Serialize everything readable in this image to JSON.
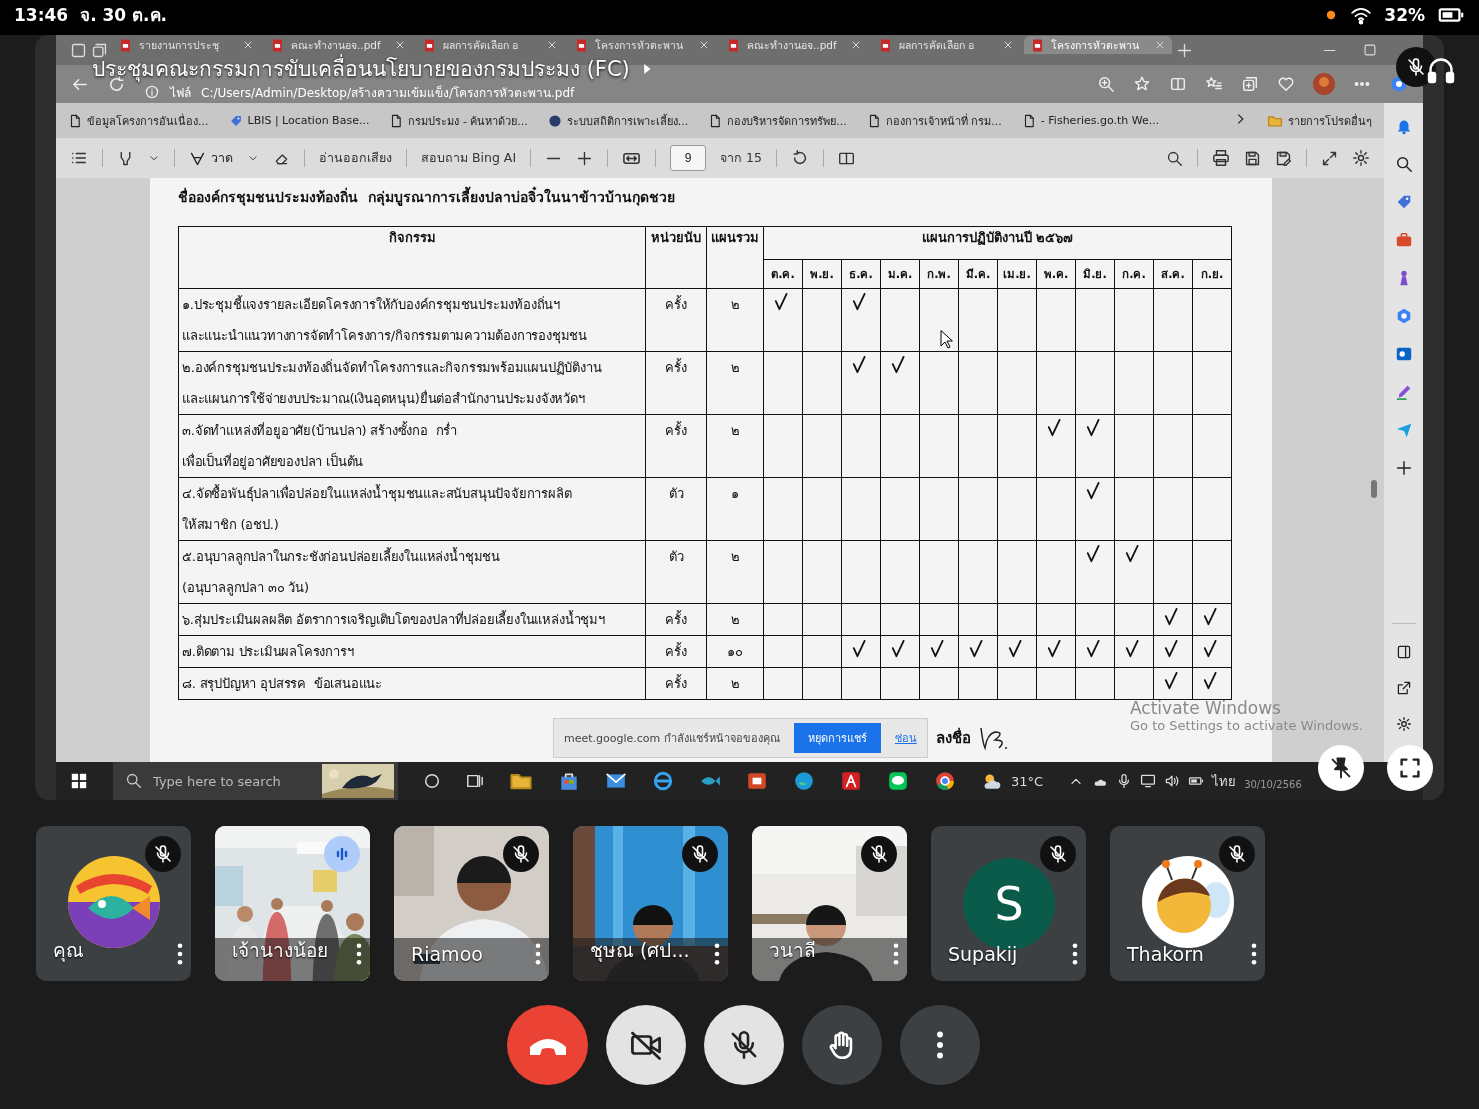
{
  "status_bar": {
    "time": "13:46",
    "date": "จ. 30 ต.ค.",
    "battery": "32%"
  },
  "meeting": {
    "title": "ประชุมคณะกรรมการขับเคลื่อนนโยบายของกรมประมง (FC)"
  },
  "browser": {
    "tabs": [
      {
        "title": "รายงานการประชุ",
        "selected": false
      },
      {
        "title": "คณะทำงานอจ..pdf",
        "selected": false
      },
      {
        "title": "ผลการคัดเลือก อ",
        "selected": false
      },
      {
        "title": "โครงการหัวตะพาน",
        "selected": false
      },
      {
        "title": "คณะทำงานอจ..pdf",
        "selected": false
      },
      {
        "title": "ผลการคัดเลือก อ",
        "selected": false
      },
      {
        "title": "โครงการหัวตะพาน",
        "selected": true
      }
    ],
    "address": {
      "scheme": "ไฟล์",
      "url": "C:/Users/Admin/Desktop/สร้างความเข้มแข็ง/โครงการหัวตะพาน.pdf"
    },
    "bookmarks": [
      "ข้อมูลโครงการอันเนื่อง...",
      "LBIS | Location Base...",
      "กรมประมง - ค้นหาด้วย...",
      "ระบบสถิติการเพาะเลี้ยง...",
      "กองบริหารจัดการทรัพย...",
      "กองการเจ้าหน้าที่ กรม...",
      "- Fisheries.go.th We..."
    ],
    "other_favorites": "รายการโปรดอื่นๆ"
  },
  "pdf_toolbar": {
    "draw": "วาด",
    "read_aloud": "อ่านออกเสียง",
    "ask": "สอบถาม Bing AI",
    "page": "9",
    "page_count": "จาก 15"
  },
  "document": {
    "heading": "ชื่อองค์กรชุมชนประมงท้องถิ่น  กลุ่มบูรณาการเลี้ยงปลาบ่อจิ๋วในนาข้าวบ้านกุดชวย",
    "table": {
      "activity_header": "กิจกรรม",
      "unit_header": "หน่วยนับ",
      "total_header": "แผนรวม",
      "plan_header": "แผนการปฏิบัติงานปี ๒๕๖๗",
      "months": [
        "ต.ค.",
        "พ.ย.",
        "ธ.ค.",
        "ม.ค.",
        "ก.พ.",
        "มี.ค.",
        "เม.ย.",
        "พ.ค.",
        "มิ.ย.",
        "ก.ค.",
        "ส.ค.",
        "ก.ย."
      ],
      "rows": [
        {
          "activity": "๑.ประชุมชี้แจงรายละเอียดโครงการให้กับองค์กรชุมชนประมงท้องถิ่นฯ\nและแนะนำแนวทางการจัดทำโครงการ/กิจกรรมตามความต้องการองชุมชน",
          "unit": "ครั้ง",
          "total": "๒",
          "plan": [
            true,
            false,
            true,
            false,
            false,
            false,
            false,
            false,
            false,
            false,
            false,
            false
          ]
        },
        {
          "activity": "๒.องค์กรชุมชนประมงท้องถิ่นจัดทำโครงการและกิจกรรมพร้อมแผนปฏิบัติงาน\nและแผนการใช้จ่ายงบประมาณ(เงินอุดหนุน)ยื่นต่อสำนักงานประมงจังหวัดฯ",
          "unit": "ครั้ง",
          "total": "๒",
          "plan": [
            false,
            false,
            true,
            true,
            false,
            false,
            false,
            false,
            false,
            false,
            false,
            false
          ]
        },
        {
          "activity": "๓.จัดทำแหล่งที่อยูอาศัย(บ้านปลา) สร้างซั้งกอ  กร่ำ\nเพื่อเป็นที่อยู่อาศัยของปลา เป็นต้น",
          "unit": "ครั้ง",
          "total": "๒",
          "plan": [
            false,
            false,
            false,
            false,
            false,
            false,
            false,
            true,
            true,
            false,
            false,
            false
          ]
        },
        {
          "activity": "๔.จัดซื้อพันธุ์ปลาเพื่อปล่อยในแหล่งน้ำชุมชนและสนับสนุนปัจจัยการผลิต\nให้สมาชิก (อชป.)",
          "unit": "ตัว",
          "total": "๑",
          "plan": [
            false,
            false,
            false,
            false,
            false,
            false,
            false,
            false,
            true,
            false,
            false,
            false
          ]
        },
        {
          "activity": "๕.อนุบาลลูกปลาในกระชังก่อนปล่อยเลี้ยงในแหล่งน้ำชุมชน\n(อนุบาลลูกปลา ๓๐ วัน)",
          "unit": "ตัว",
          "total": "๒",
          "plan": [
            false,
            false,
            false,
            false,
            false,
            false,
            false,
            false,
            true,
            true,
            false,
            false
          ]
        },
        {
          "activity": "๖.สุ่มประเมินผลผลิต อัตราการเจริญเติบโตของปลาที่ปล่อยเลี้ยงในแหล่งน้ำชุมฯ",
          "unit": "ครั้ง",
          "total": "๒",
          "plan": [
            false,
            false,
            false,
            false,
            false,
            false,
            false,
            false,
            false,
            false,
            true,
            true
          ]
        },
        {
          "activity": "๗.ติดตาม ประเมินผลโครงการฯ",
          "unit": "ครั้ง",
          "total": "๑๐",
          "plan": [
            false,
            false,
            true,
            true,
            true,
            true,
            true,
            true,
            true,
            true,
            true,
            true
          ]
        },
        {
          "activity": "๘. สรุปปัญหา อุปสรรค  ข้อเสนอแนะ",
          "unit": "ครั้ง",
          "total": "๒",
          "plan": [
            false,
            false,
            false,
            false,
            false,
            false,
            false,
            false,
            false,
            false,
            true,
            true
          ]
        }
      ]
    },
    "signature_label": "ลงชื่อ"
  },
  "share_banner": {
    "message": "meet.google.com กำลังแชร์หน้าจอของคุณ",
    "stop": "หยุดการแชร์",
    "hide": "ซ่อน"
  },
  "activation_notice": {
    "title": "Activate Windows",
    "text": "Go to Settings to activate Windows."
  },
  "taskbar": {
    "search_placeholder": "Type here to search",
    "temperature": "31°C",
    "language": "ไทย",
    "date": "30/10/2566"
  },
  "participants": [
    {
      "name": "คุณ",
      "kind": "logo",
      "muted": true
    },
    {
      "name": "เจ้านางน้อย",
      "kind": "video",
      "muted": false
    },
    {
      "name": "Riamoo",
      "kind": "video",
      "muted": true
    },
    {
      "name": "ชุษณ (ศป...",
      "kind": "video",
      "muted": true
    },
    {
      "name": "วนาลี",
      "kind": "video",
      "muted": true
    },
    {
      "name": "Supakij",
      "kind": "letter",
      "initial": "S",
      "muted": true
    },
    {
      "name": "Thakorn",
      "kind": "mascot",
      "muted": true
    }
  ],
  "controls": {
    "camera_on": false,
    "mic_on": false
  }
}
